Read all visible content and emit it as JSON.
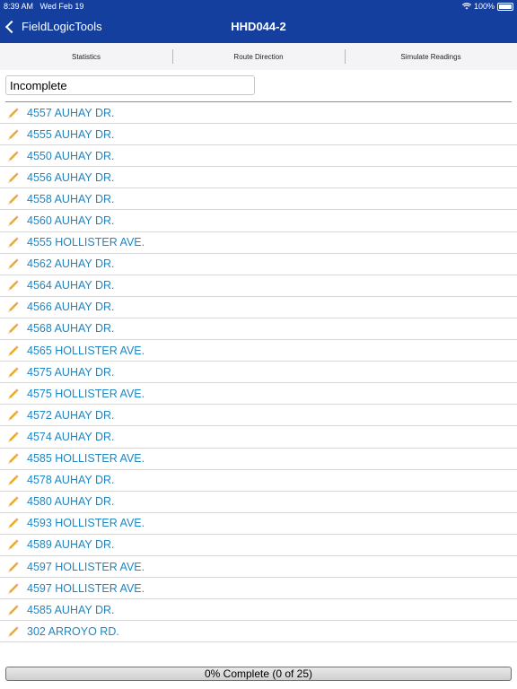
{
  "status_bar": {
    "time": "8:39 AM",
    "date": "Wed Feb 19",
    "battery": "100%"
  },
  "navbar": {
    "back_label": "FieldLogicTools",
    "title": "HHD044-2"
  },
  "tabs": [
    {
      "label": "Statistics"
    },
    {
      "label": "Route Direction"
    },
    {
      "label": "Simulate Readings"
    }
  ],
  "filter": {
    "value": "Incomplete"
  },
  "addresses": [
    "4557 AUHAY DR.",
    "4555 AUHAY DR.",
    "4550 AUHAY DR.",
    "4556 AUHAY DR.",
    "4558 AUHAY DR.",
    "4560 AUHAY DR.",
    "4555 HOLLISTER AVE.",
    "4562 AUHAY DR.",
    "4564 AUHAY DR.",
    "4566 AUHAY DR.",
    "4568 AUHAY DR.",
    "4565 HOLLISTER AVE.",
    "4575 AUHAY DR.",
    "4575 HOLLISTER AVE.",
    "4572 AUHAY DR.",
    "4574 AUHAY DR.",
    "4585 HOLLISTER AVE.",
    "4578 AUHAY DR.",
    "4580 AUHAY DR.",
    "4593 HOLLISTER AVE.",
    "4589 AUHAY DR.",
    "4597 HOLLISTER AVE.",
    "4597 HOLLISTER AVE.",
    "4585 AUHAY DR.",
    "302  ARROYO RD."
  ],
  "progress": {
    "label": "0% Complete (0 of 25)",
    "fraction": 0
  },
  "colors": {
    "navbar": "#143f9e",
    "link": "#1f86c2"
  }
}
